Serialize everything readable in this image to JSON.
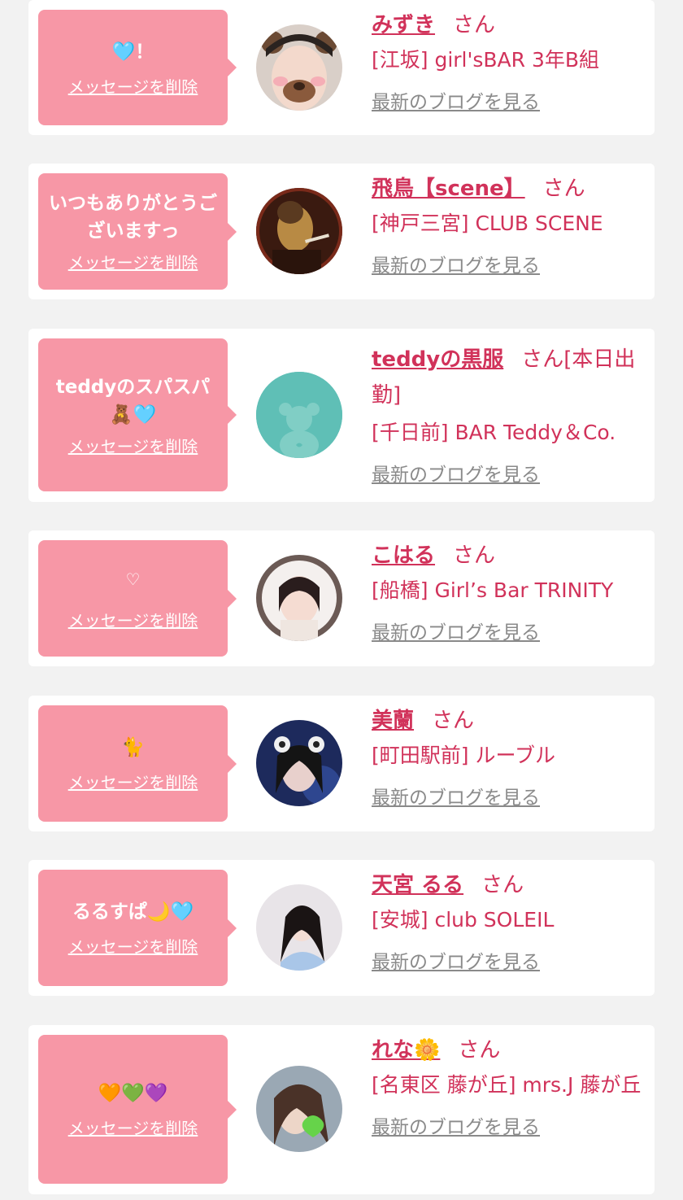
{
  "delete_label": "メッセージを削除",
  "blog_label": "最新のブログを見る",
  "honorific": "さん",
  "colors": {
    "background": "#f2f2f2",
    "card": "#ffffff",
    "bubble": "#f797a6",
    "name": "#d1325a",
    "link_gray": "#8a8a8a"
  },
  "items": [
    {
      "message": "🩵！",
      "name": "みずき",
      "shop": "[江坂] girl'sBAR 3年B組",
      "avatar": "avatar-bear-filter-selfie"
    },
    {
      "message": "いつもありがとうございますっ",
      "name": "飛鳥【scene】",
      "shop": "[神戸三宮] CLUB SCENE",
      "avatar": "avatar-dark-smoking"
    },
    {
      "message": "teddyのスパスパ🧸🩵",
      "name": "teddyの黒服",
      "name_suffix": "[本日出勤]",
      "shop": "[千日前] BAR Teddy＆Co.",
      "avatar": "teddy-bear-icon"
    },
    {
      "message": "♡",
      "name": "こはる",
      "shop": "[船橋] Girl’s Bar TRINITY",
      "avatar": "avatar-white-hood"
    },
    {
      "message": "🐈",
      "name": "美蘭",
      "shop": "[町田駅前] ルーブル",
      "avatar": "avatar-blue-filter"
    },
    {
      "message": "るるすぱ🌙🩵",
      "name": "天宮 るる",
      "shop": "[安城] club SOLEIL",
      "avatar": "avatar-portrait"
    },
    {
      "message": "🧡💚💜",
      "name": "れな🌼",
      "shop": "[名東区 藤が丘] mrs.J 藤が丘",
      "avatar": "avatar-green-heart"
    }
  ]
}
